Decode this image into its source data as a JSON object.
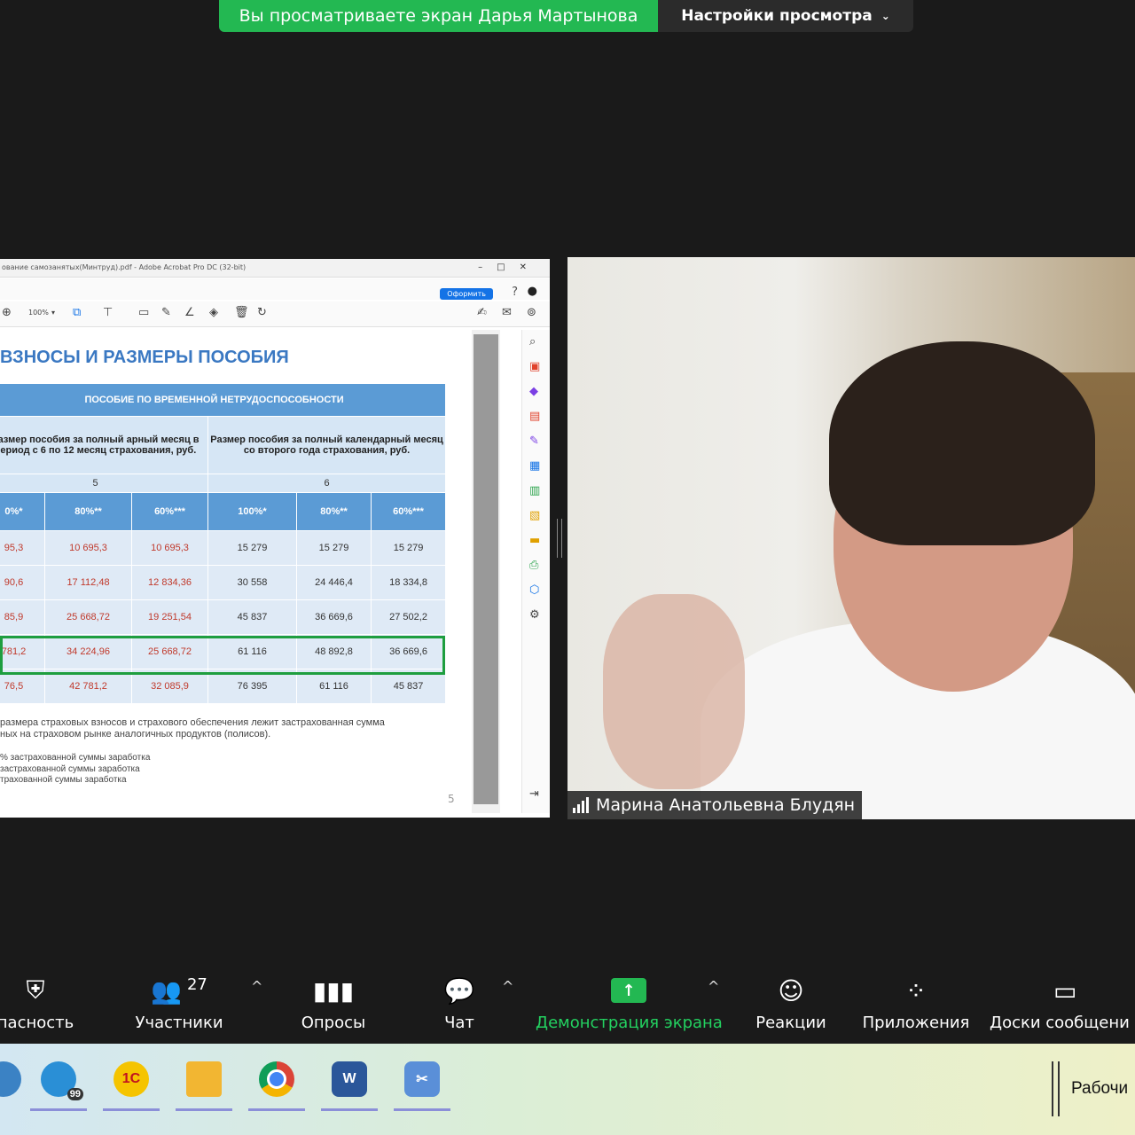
{
  "share_banner": {
    "viewing_text": "Вы просматриваете экран Дарья Мартынова",
    "settings_label": "Настройки просмотра"
  },
  "acrobat": {
    "title": "ование самозанятых(Минтруд).pdf - Adobe Acrobat Pro DC (32-bit)",
    "oform_button": "Оформить",
    "zoom": "100%",
    "page_number": "5",
    "doc_title": "ВЗНОСЫ И РАЗМЕРЫ ПОСОБИЯ",
    "table": {
      "header_main": "ПОСОБИЕ ПО ВРЕМЕННОЙ НЕТРУДОСПОСОБНОСТИ",
      "header_col_a": "Размер пособия за полный арный месяц в период с 6 по 12 месяц страхования, руб.",
      "header_col_b": "Размер пособия за полный календарный месяц со второго года страхования, руб.",
      "num_a": "5",
      "num_b": "6",
      "pct": [
        "0%*",
        "80%**",
        "60%***",
        "100%*",
        "80%**",
        "60%***"
      ],
      "rows": [
        [
          "95,3",
          "10 695,3",
          "10 695,3",
          "15 279",
          "15 279",
          "15 279"
        ],
        [
          "90,6",
          "17 112,48",
          "12 834,36",
          "30 558",
          "24 446,4",
          "18 334,8"
        ],
        [
          "85,9",
          "25 668,72",
          "19 251,54",
          "45 837",
          "36 669,6",
          "27 502,2"
        ],
        [
          "781,2",
          "34 224,96",
          "25 668,72",
          "61 116",
          "48 892,8",
          "36 669,6"
        ],
        [
          "76,5",
          "42 781,2",
          "32 085,9",
          "76 395",
          "61 116",
          "45 837"
        ]
      ]
    },
    "footnote_1": "размера страховых взносов и страхового обеспечения лежит застрахованная сумма",
    "footnote_2": "ных на страховом рынке аналогичных продуктов (полисов).",
    "footnote_3": "% застрахованной суммы заработка",
    "footnote_4": "застрахованной суммы заработка",
    "footnote_5": "трахованной суммы заработка"
  },
  "video": {
    "participant_name": "Марина Анатольевна Блудян"
  },
  "zoom_toolbar": {
    "security_label": "пасность",
    "participants_label": "Участники",
    "participants_count": "27",
    "polls_label": "Опросы",
    "chat_label": "Чат",
    "share_label": "Демонстрация экрана",
    "reactions_label": "Реакции",
    "apps_label": "Приложения",
    "whiteboards_label": "Доски сообщени"
  },
  "taskbar": {
    "desktop_label": "Рабочи",
    "badge_count": "99",
    "accent_color": "#8b8fd8"
  }
}
